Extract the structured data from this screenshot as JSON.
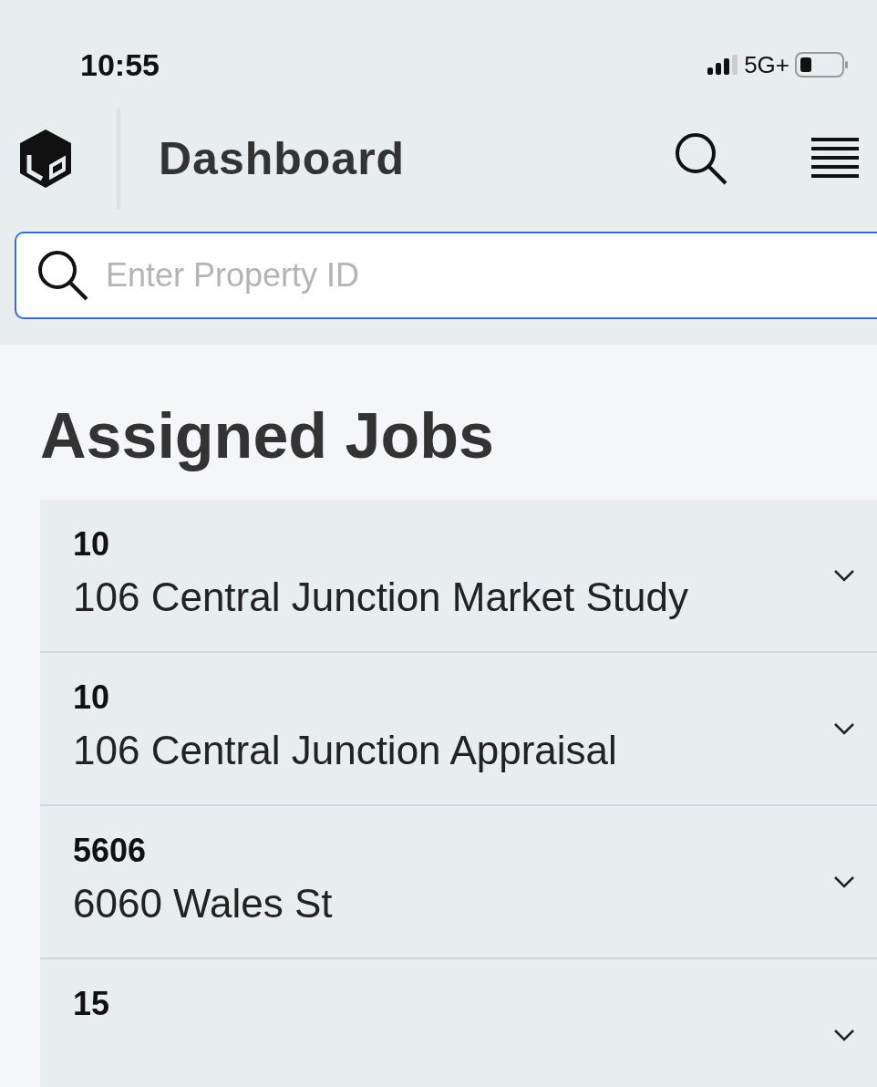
{
  "status_bar": {
    "time": "10:55",
    "network": "5G+"
  },
  "header": {
    "title": "Dashboard"
  },
  "search": {
    "placeholder": "Enter Property ID"
  },
  "section": {
    "title": "Assigned Jobs"
  },
  "jobs": [
    {
      "id": "10",
      "title": "106 Central Junction Market Study",
      "expanded": false
    },
    {
      "id": "10",
      "title": "106 Central Junction Appraisal",
      "expanded": false
    },
    {
      "id": "5606",
      "title": "6060 Wales St",
      "expanded": false
    },
    {
      "id": "15",
      "expanded": false
    }
  ]
}
